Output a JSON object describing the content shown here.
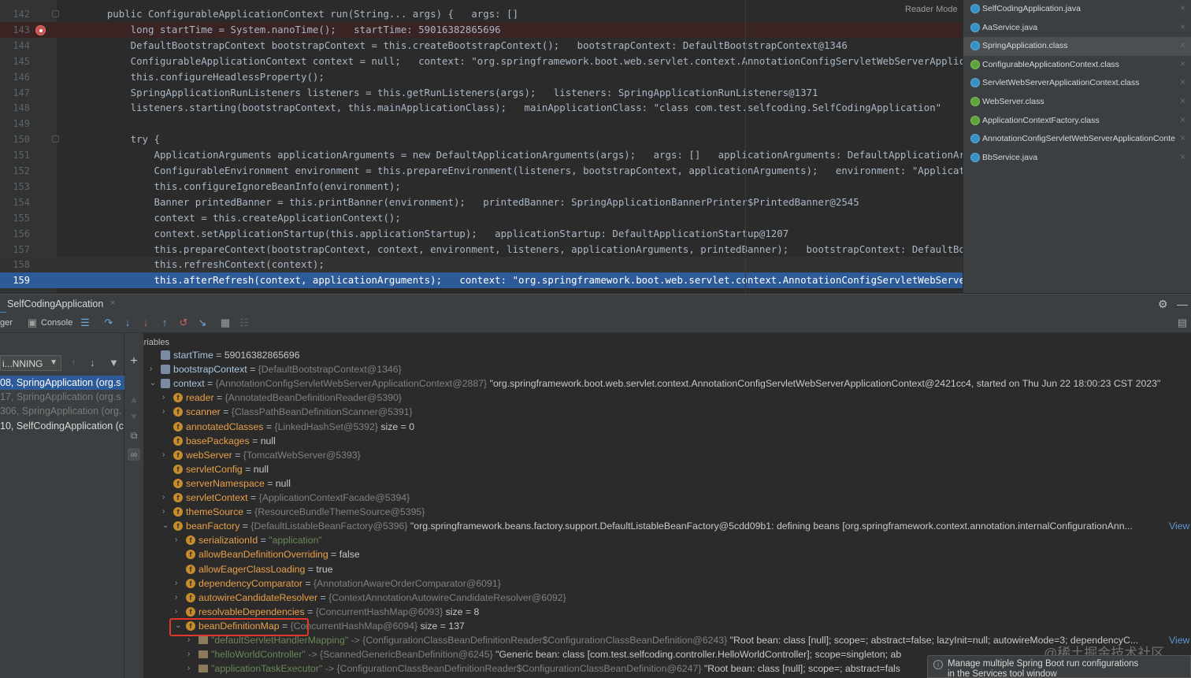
{
  "editor": {
    "reader_mode": "Reader Mode",
    "lines": [
      {
        "num": "142",
        "text": "    public ConfigurableApplicationContext run(String... args) {   args: []",
        "state": "normal"
      },
      {
        "num": "143",
        "text": "        long startTime = System.nanoTime();   startTime: 59016382865696",
        "state": "breakpoint"
      },
      {
        "num": "144",
        "text": "        DefaultBootstrapContext bootstrapContext = this.createBootstrapContext();   bootstrapContext: DefaultBootstrapContext@1346",
        "state": "normal"
      },
      {
        "num": "145",
        "text": "        ConfigurableApplicationContext context = null;   context: \"org.springframework.boot.web.servlet.context.AnnotationConfigServletWebServerApplicationCont",
        "state": "normal"
      },
      {
        "num": "146",
        "text": "        this.configureHeadlessProperty();",
        "state": "normal"
      },
      {
        "num": "147",
        "text": "        SpringApplicationRunListeners listeners = this.getRunListeners(args);   listeners: SpringApplicationRunListeners@1371",
        "state": "normal"
      },
      {
        "num": "148",
        "text": "        listeners.starting(bootstrapContext, this.mainApplicationClass);   mainApplicationClass: \"class com.test.selfcoding.SelfCodingApplication\"",
        "state": "normal"
      },
      {
        "num": "149",
        "text": "",
        "state": "normal"
      },
      {
        "num": "150",
        "text": "        try {",
        "state": "normal"
      },
      {
        "num": "151",
        "text": "            ApplicationArguments applicationArguments = new DefaultApplicationArguments(args);   args: []   applicationArguments: DefaultApplicationArguments@",
        "state": "normal"
      },
      {
        "num": "152",
        "text": "            ConfigurableEnvironment environment = this.prepareEnvironment(listeners, bootstrapContext, applicationArguments);   environment: \"ApplicationServle",
        "state": "normal"
      },
      {
        "num": "153",
        "text": "            this.configureIgnoreBeanInfo(environment);",
        "state": "normal"
      },
      {
        "num": "154",
        "text": "            Banner printedBanner = this.printBanner(environment);   printedBanner: SpringApplicationBannerPrinter$PrintedBanner@2545",
        "state": "normal"
      },
      {
        "num": "155",
        "text": "            context = this.createApplicationContext();",
        "state": "normal"
      },
      {
        "num": "156",
        "text": "            context.setApplicationStartup(this.applicationStartup);   applicationStartup: DefaultApplicationStartup@1207",
        "state": "normal"
      },
      {
        "num": "157",
        "text": "            this.prepareContext(bootstrapContext, context, environment, listeners, applicationArguments, printedBanner);   bootstrapContext: DefaultBootstrapCo",
        "state": "normal"
      },
      {
        "num": "158",
        "text": "            this.refreshContext(context);",
        "state": "hover"
      },
      {
        "num": "159",
        "text": "            this.afterRefresh(context, applicationArguments);   context: \"org.springframework.boot.web.servlet.context.AnnotationConfigServletWebServerApplicat",
        "state": "current"
      }
    ]
  },
  "files": [
    {
      "name": "SelfCodingApplication.java",
      "kind": "java",
      "selected": false
    },
    {
      "name": "AaService.java",
      "kind": "java",
      "selected": false
    },
    {
      "name": "SpringApplication.class",
      "kind": "java",
      "selected": true
    },
    {
      "name": "ConfigurableApplicationContext.class",
      "kind": "spring",
      "selected": false
    },
    {
      "name": "ServletWebServerApplicationContext.class",
      "kind": "java",
      "selected": false
    },
    {
      "name": "WebServer.class",
      "kind": "spring",
      "selected": false
    },
    {
      "name": "ApplicationContextFactory.class",
      "kind": "spring",
      "selected": false
    },
    {
      "name": "AnnotationConfigServletWebServerApplicationConte",
      "kind": "java",
      "selected": false
    },
    {
      "name": "BbService.java",
      "kind": "java",
      "selected": false
    }
  ],
  "debug": {
    "run_tab": "SelfCodingApplication",
    "tab_close": "×",
    "toolbar": {
      "debugger_label": "ger",
      "console_label": "Console"
    },
    "thread_value": "i...NNING",
    "frames": [
      {
        "text": "08, SpringApplication (org.s",
        "state": "sel"
      },
      {
        "text": "17, SpringApplication (org.s",
        "state": "dim"
      },
      {
        "text": "306, SpringApplication (org.",
        "state": "dim"
      },
      {
        "text": "10, SelfCodingApplication (c",
        "state": "norm"
      }
    ],
    "variables_title": "Variables",
    "variables": [
      {
        "depth": 0,
        "arrow": "",
        "icon": "local",
        "name": "startTime",
        "name_kind": "local",
        "ref": "",
        "value": "59016382865696",
        "value_kind": "plain"
      },
      {
        "depth": 0,
        "arrow": "›",
        "icon": "local",
        "name": "bootstrapContext",
        "name_kind": "local",
        "ref": "{DefaultBootstrapContext@1346}",
        "value": "",
        "value_kind": "plain"
      },
      {
        "depth": 0,
        "arrow": "⌄",
        "icon": "local",
        "name": "context",
        "name_kind": "local",
        "ref": "{AnnotationConfigServletWebServerApplicationContext@2887}",
        "value": "\"org.springframework.boot.web.servlet.context.AnnotationConfigServletWebServerApplicationContext@2421cc4, started on Thu Jun 22 18:00:23 CST 2023\"",
        "value_kind": "plain"
      },
      {
        "depth": 1,
        "arrow": "›",
        "icon": "field",
        "name": "reader",
        "name_kind": "field",
        "ref": "{AnnotatedBeanDefinitionReader@5390}",
        "value": "",
        "value_kind": "plain"
      },
      {
        "depth": 1,
        "arrow": "›",
        "icon": "field",
        "name": "scanner",
        "name_kind": "field",
        "ref": "{ClassPathBeanDefinitionScanner@5391}",
        "value": "",
        "value_kind": "plain"
      },
      {
        "depth": 1,
        "arrow": "",
        "icon": "field",
        "name": "annotatedClasses",
        "name_kind": "field",
        "ref": "{LinkedHashSet@5392}",
        "value": "size = 0",
        "value_kind": "plain"
      },
      {
        "depth": 1,
        "arrow": "",
        "icon": "field",
        "name": "basePackages",
        "name_kind": "field",
        "ref": "",
        "value": "null",
        "value_kind": "plain"
      },
      {
        "depth": 1,
        "arrow": "›",
        "icon": "field",
        "name": "webServer",
        "name_kind": "field",
        "ref": "{TomcatWebServer@5393}",
        "value": "",
        "value_kind": "plain"
      },
      {
        "depth": 1,
        "arrow": "",
        "icon": "field",
        "name": "servletConfig",
        "name_kind": "field",
        "ref": "",
        "value": "null",
        "value_kind": "plain"
      },
      {
        "depth": 1,
        "arrow": "",
        "icon": "field",
        "name": "serverNamespace",
        "name_kind": "field",
        "ref": "",
        "value": "null",
        "value_kind": "plain"
      },
      {
        "depth": 1,
        "arrow": "›",
        "icon": "field",
        "name": "servletContext",
        "name_kind": "field",
        "ref": "{ApplicationContextFacade@5394}",
        "value": "",
        "value_kind": "plain"
      },
      {
        "depth": 1,
        "arrow": "›",
        "icon": "field",
        "name": "themeSource",
        "name_kind": "field",
        "ref": "{ResourceBundleThemeSource@5395}",
        "value": "",
        "value_kind": "plain"
      },
      {
        "depth": 1,
        "arrow": "⌄",
        "icon": "field",
        "name": "beanFactory",
        "name_kind": "field",
        "ref": "{DefaultListableBeanFactory@5396}",
        "value": "\"org.springframework.beans.factory.support.DefaultListableBeanFactory@5cdd09b1: defining beans [org.springframework.context.annotation.internalConfigurationAnn...",
        "value_kind": "plain",
        "link": "View"
      },
      {
        "depth": 2,
        "arrow": "›",
        "icon": "field",
        "name": "serializationId",
        "name_kind": "field",
        "ref": "",
        "value": "\"application\"",
        "value_kind": "str"
      },
      {
        "depth": 2,
        "arrow": "",
        "icon": "field",
        "name": "allowBeanDefinitionOverriding",
        "name_kind": "field",
        "ref": "",
        "value": "false",
        "value_kind": "plain"
      },
      {
        "depth": 2,
        "arrow": "",
        "icon": "field",
        "name": "allowEagerClassLoading",
        "name_kind": "field",
        "ref": "",
        "value": "true",
        "value_kind": "plain"
      },
      {
        "depth": 2,
        "arrow": "›",
        "icon": "field",
        "name": "dependencyComparator",
        "name_kind": "field",
        "ref": "{AnnotationAwareOrderComparator@6091}",
        "value": "",
        "value_kind": "plain"
      },
      {
        "depth": 2,
        "arrow": "›",
        "icon": "field",
        "name": "autowireCandidateResolver",
        "name_kind": "field",
        "ref": "{ContextAnnotationAutowireCandidateResolver@6092}",
        "value": "",
        "value_kind": "plain"
      },
      {
        "depth": 2,
        "arrow": "›",
        "icon": "field",
        "name": "resolvableDependencies",
        "name_kind": "field",
        "ref": "{ConcurrentHashMap@6093}",
        "value": "size = 8",
        "value_kind": "plain"
      },
      {
        "depth": 2,
        "arrow": "⌄",
        "icon": "field",
        "name": "beanDefinitionMap",
        "name_kind": "field",
        "ref": "{ConcurrentHashMap@6094}",
        "value": "size = 137",
        "value_kind": "plain"
      },
      {
        "depth": 3,
        "arrow": "›",
        "icon": "entry",
        "name": "\"defaultServletHandlerMapping\"",
        "name_kind": "str",
        "ref": "-> {ConfigurationClassBeanDefinitionReader$ConfigurationClassBeanDefinition@6243}",
        "value": "\"Root bean: class [null]; scope=; abstract=false; lazyInit=null; autowireMode=3; dependencyC...",
        "value_kind": "plain",
        "link": "View"
      },
      {
        "depth": 3,
        "arrow": "›",
        "icon": "entry",
        "name": "\"helloWorldController\"",
        "name_kind": "str",
        "ref": "-> {ScannedGenericBeanDefinition@6245}",
        "value": "\"Generic bean: class [com.test.selfcoding.controller.HelloWorldController]; scope=singleton; ab",
        "value_kind": "plain"
      },
      {
        "depth": 3,
        "arrow": "›",
        "icon": "entry",
        "name": "\"applicationTaskExecutor\"",
        "name_kind": "str",
        "ref": "-> {ConfigurationClassBeanDefinitionReader$ConfigurationClassBeanDefinition@6247}",
        "value": "\"Root bean: class [null]; scope=; abstract=fals",
        "value_kind": "plain"
      }
    ]
  },
  "notification": {
    "text_line1": "Manage multiple Spring Boot run configurations",
    "text_line2": "in the Services tool window"
  },
  "watermark": "@稀土掘金技术社区",
  "colors": {
    "accent": "#2d5a99",
    "highlight_box": "#e0382c",
    "field_icon": "#c68b2a"
  }
}
